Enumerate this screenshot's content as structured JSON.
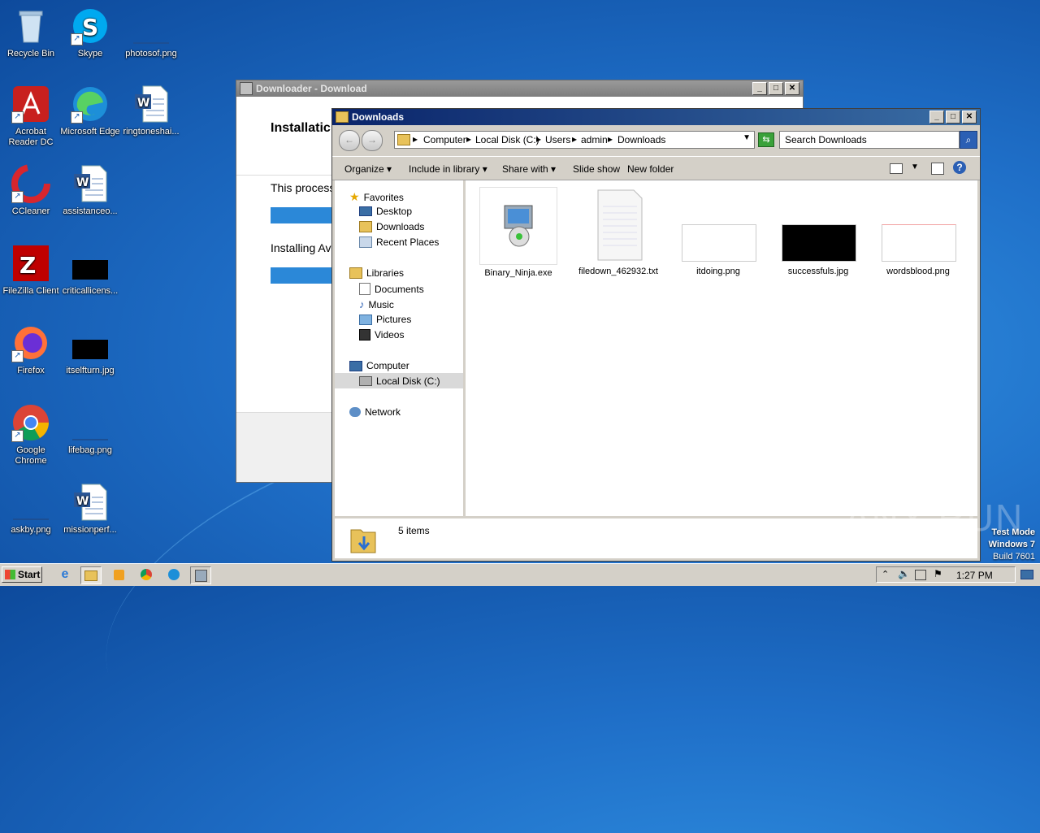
{
  "desktop": {
    "icons": [
      {
        "label": "Recycle Bin"
      },
      {
        "label": "Skype"
      },
      {
        "label": "photosof.png"
      },
      {
        "label": "Acrobat Reader DC"
      },
      {
        "label": "Microsoft Edge"
      },
      {
        "label": "ringtoneshai..."
      },
      {
        "label": "CCleaner"
      },
      {
        "label": "assistanceo..."
      },
      {
        "label": "FileZilla Client"
      },
      {
        "label": "criticallicens..."
      },
      {
        "label": "Firefox"
      },
      {
        "label": "itselfturn.jpg"
      },
      {
        "label": "Google Chrome"
      },
      {
        "label": "lifebag.png"
      },
      {
        "label": "askby.png"
      },
      {
        "label": "missionperf..."
      }
    ]
  },
  "downloader": {
    "title": "Downloader - Download",
    "heading": "Installatic",
    "process_text": "This process",
    "installing_text": "Installing Av"
  },
  "explorer": {
    "title": "Downloads",
    "breadcrumb": [
      "Computer",
      "Local Disk (C:)",
      "Users",
      "admin",
      "Downloads"
    ],
    "search_placeholder": "Search Downloads",
    "toolbar": {
      "organize": "Organize",
      "include": "Include in library",
      "share": "Share with",
      "slideshow": "Slide show",
      "newfolder": "New folder"
    },
    "nav": {
      "favorites": "Favorites",
      "desktop": "Desktop",
      "downloads": "Downloads",
      "recent": "Recent Places",
      "libraries": "Libraries",
      "documents": "Documents",
      "music": "Music",
      "pictures": "Pictures",
      "videos": "Videos",
      "computer": "Computer",
      "localdisk": "Local Disk (C:)",
      "network": "Network"
    },
    "files": [
      {
        "name": "Binary_Ninja.exe"
      },
      {
        "name": "filedown_462932.txt"
      },
      {
        "name": "itdoing.png"
      },
      {
        "name": "successfuls.jpg"
      },
      {
        "name": "wordsblood.png"
      }
    ],
    "status": "5 items"
  },
  "taskbar": {
    "start": "Start",
    "clock": "1:27 PM"
  },
  "watermark": {
    "brand": "ANY RUN",
    "line1": "Test Mode",
    "line2": "Windows 7",
    "line3": "Build 7601"
  },
  "colors": {
    "titlebar_active": "#0a246a",
    "titlebar_inactive": "#808080",
    "accent_blue": "#2b88d8"
  }
}
